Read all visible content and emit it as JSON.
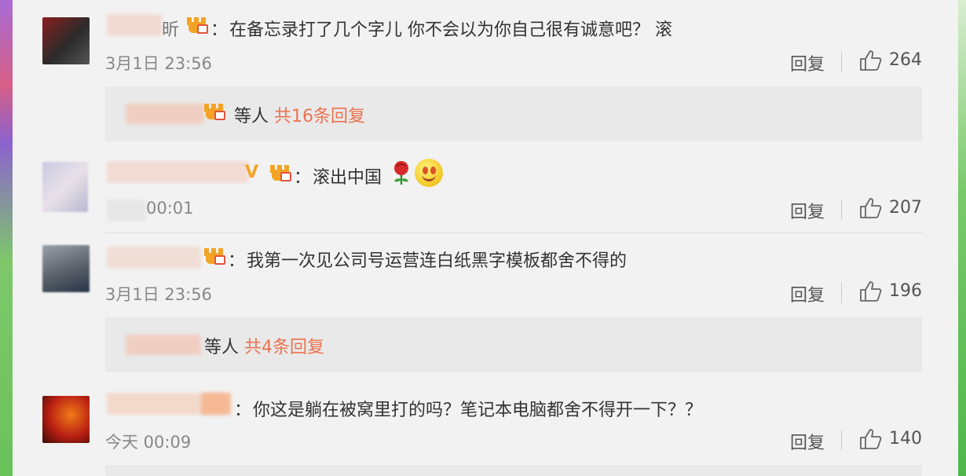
{
  "comments": [
    {
      "text": "在备忘录打了几个字儿 你不会以为你自己很有诚意吧？ 滚",
      "time": "3月1日 23:56",
      "reply_label": "回复",
      "likes": "264",
      "thread": {
        "prefix": "等人",
        "count": "共16条回复"
      }
    },
    {
      "text": "滚出中国",
      "time": "00:01",
      "reply_label": "回复",
      "likes": "207"
    },
    {
      "text": "我第一次见公司号运营连白纸黑字模板都舍不得的",
      "time": "3月1日 23:56",
      "reply_label": "回复",
      "likes": "196",
      "thread": {
        "prefix": "等人",
        "count": "共4条回复"
      }
    },
    {
      "text": "你这是躺在被窝里打的吗？笔记本电脑都舍不得开一下？？",
      "time": "今天 00:09",
      "reply_label": "回复",
      "likes": "140"
    }
  ],
  "name_fragments": {
    "c1": "昕",
    "c2": "V"
  },
  "colon": "：",
  "icons": {
    "like": "thumbs-up-icon",
    "badge": "crown-badge-icon",
    "rose": "rose-emoji-icon",
    "smile": "smile-emoji-icon"
  },
  "colors": {
    "accent": "#eb7350",
    "text": "#333333",
    "muted": "#888888",
    "background": "#f2f2f2"
  }
}
